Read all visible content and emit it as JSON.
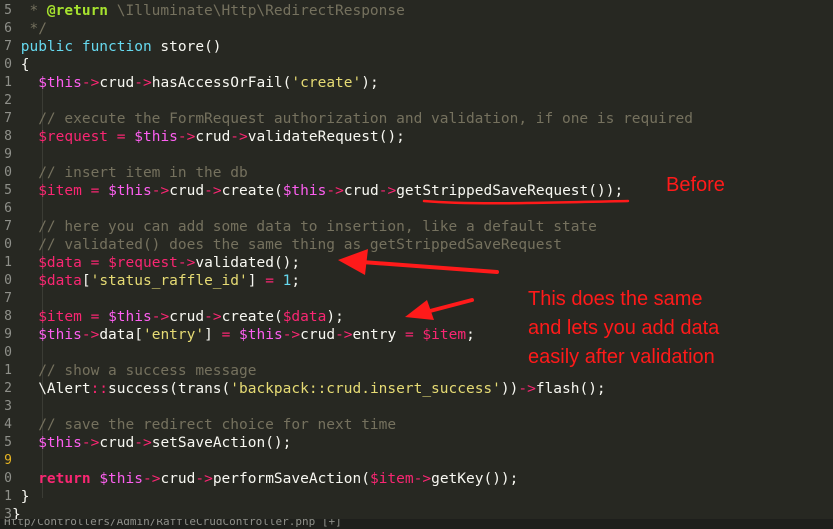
{
  "editor": {
    "lines": [
      {
        "n": "5",
        "mod": false,
        "tokens": [
          [
            "cm",
            "  * "
          ],
          [
            "doc",
            "@return"
          ],
          [
            "cm",
            " \\Illuminate\\Http\\RedirectResponse"
          ]
        ]
      },
      {
        "n": "6",
        "mod": false,
        "tokens": [
          [
            "cm",
            "  */"
          ]
        ]
      },
      {
        "n": "7",
        "mod": false,
        "tokens": [
          [
            "kw",
            " public"
          ],
          [
            "fg",
            " "
          ],
          [
            "kw",
            "function"
          ],
          [
            "fg",
            " store()"
          ]
        ]
      },
      {
        "n": "0",
        "mod": false,
        "tokens": [
          [
            "fg",
            " {"
          ]
        ]
      },
      {
        "n": "1",
        "mod": false,
        "tokens": [
          [
            "fg",
            "   "
          ],
          [
            "var",
            "$this"
          ],
          [
            "op",
            "->"
          ],
          [
            "fg",
            "crud"
          ],
          [
            "op",
            "->"
          ],
          [
            "fg",
            "hasAccessOrFail("
          ],
          [
            "str",
            "'create'"
          ],
          [
            "fg",
            ");"
          ]
        ]
      },
      {
        "n": "2",
        "mod": false,
        "tokens": []
      },
      {
        "n": "7",
        "mod": false,
        "tokens": [
          [
            "cm",
            "   // execute the FormRequest authorization and validation, if one is required"
          ]
        ]
      },
      {
        "n": "8",
        "mod": false,
        "tokens": [
          [
            "fg",
            "   "
          ],
          [
            "vr",
            "$request"
          ],
          [
            "op",
            " = "
          ],
          [
            "var",
            "$this"
          ],
          [
            "op",
            "->"
          ],
          [
            "fg",
            "crud"
          ],
          [
            "op",
            "->"
          ],
          [
            "fg",
            "validateRequest();"
          ]
        ]
      },
      {
        "n": "9",
        "mod": false,
        "tokens": []
      },
      {
        "n": "0",
        "mod": false,
        "tokens": [
          [
            "cm",
            "   // insert item in the db"
          ]
        ]
      },
      {
        "n": "5",
        "mod": false,
        "tokens": [
          [
            "fg",
            "   "
          ],
          [
            "vr",
            "$item"
          ],
          [
            "op",
            " = "
          ],
          [
            "var",
            "$this"
          ],
          [
            "op",
            "->"
          ],
          [
            "fg",
            "crud"
          ],
          [
            "op",
            "->"
          ],
          [
            "fg",
            "create("
          ],
          [
            "var",
            "$this"
          ],
          [
            "op",
            "->"
          ],
          [
            "fg",
            "crud"
          ],
          [
            "op",
            "->"
          ],
          [
            "fg",
            "getStrippedSaveRequest());"
          ]
        ]
      },
      {
        "n": "6",
        "mod": false,
        "tokens": []
      },
      {
        "n": "7",
        "mod": false,
        "tokens": [
          [
            "cm",
            "   // here you can add some data to insertion, like a default state"
          ]
        ]
      },
      {
        "n": "0",
        "mod": false,
        "tokens": [
          [
            "cm",
            "   // validated() does the same thing as getStrippedSaveRequest"
          ]
        ]
      },
      {
        "n": "1",
        "mod": false,
        "tokens": [
          [
            "fg",
            "   "
          ],
          [
            "vr",
            "$data"
          ],
          [
            "op",
            " = "
          ],
          [
            "vr",
            "$request"
          ],
          [
            "op",
            "->"
          ],
          [
            "fg",
            "validated();"
          ]
        ]
      },
      {
        "n": "0",
        "mod": false,
        "tokens": [
          [
            "fg",
            "   "
          ],
          [
            "vr",
            "$data"
          ],
          [
            "fg",
            "["
          ],
          [
            "str",
            "'status_raffle_id'"
          ],
          [
            "fg",
            "] "
          ],
          [
            "op",
            "="
          ],
          [
            "fg",
            " "
          ],
          [
            "kw",
            "1"
          ],
          [
            "fg",
            ";"
          ]
        ]
      },
      {
        "n": "7",
        "mod": false,
        "tokens": []
      },
      {
        "n": "8",
        "mod": false,
        "tokens": [
          [
            "fg",
            "   "
          ],
          [
            "vr",
            "$item"
          ],
          [
            "op",
            " = "
          ],
          [
            "var",
            "$this"
          ],
          [
            "op",
            "->"
          ],
          [
            "fg",
            "crud"
          ],
          [
            "op",
            "->"
          ],
          [
            "fg",
            "create("
          ],
          [
            "vr",
            "$data"
          ],
          [
            "fg",
            ");"
          ]
        ]
      },
      {
        "n": "9",
        "mod": false,
        "tokens": [
          [
            "fg",
            "   "
          ],
          [
            "var",
            "$this"
          ],
          [
            "op",
            "->"
          ],
          [
            "fg",
            "data["
          ],
          [
            "str",
            "'entry'"
          ],
          [
            "fg",
            "] "
          ],
          [
            "op",
            "="
          ],
          [
            "fg",
            " "
          ],
          [
            "var",
            "$this"
          ],
          [
            "op",
            "->"
          ],
          [
            "fg",
            "crud"
          ],
          [
            "op",
            "->"
          ],
          [
            "fg",
            "entry "
          ],
          [
            "op",
            "="
          ],
          [
            "fg",
            " "
          ],
          [
            "vr",
            "$item"
          ],
          [
            "fg",
            ";"
          ]
        ]
      },
      {
        "n": "0",
        "mod": false,
        "tokens": []
      },
      {
        "n": "1",
        "mod": false,
        "tokens": [
          [
            "cm",
            "   // show a success message"
          ]
        ]
      },
      {
        "n": "2",
        "mod": false,
        "tokens": [
          [
            "fg",
            "   \\Alert"
          ],
          [
            "op",
            "::"
          ],
          [
            "fg",
            "success(trans("
          ],
          [
            "str",
            "'backpack::crud.insert_success'"
          ],
          [
            "fg",
            "))"
          ],
          [
            "op",
            "->"
          ],
          [
            "fg",
            "flash();"
          ]
        ]
      },
      {
        "n": "3",
        "mod": false,
        "tokens": []
      },
      {
        "n": "4",
        "mod": false,
        "tokens": [
          [
            "cm",
            "   // save the redirect choice for next time"
          ]
        ]
      },
      {
        "n": "5",
        "mod": false,
        "tokens": [
          [
            "fg",
            "   "
          ],
          [
            "var",
            "$this"
          ],
          [
            "op",
            "->"
          ],
          [
            "fg",
            "crud"
          ],
          [
            "op",
            "->"
          ],
          [
            "fg",
            "setSaveAction();"
          ]
        ]
      },
      {
        "n": "9",
        "mod": true,
        "tokens": []
      },
      {
        "n": "0",
        "mod": false,
        "tokens": [
          [
            "ret",
            "   return"
          ],
          [
            "fg",
            " "
          ],
          [
            "var",
            "$this"
          ],
          [
            "op",
            "->"
          ],
          [
            "fg",
            "crud"
          ],
          [
            "op",
            "->"
          ],
          [
            "fg",
            "performSaveAction("
          ],
          [
            "vr",
            "$item"
          ],
          [
            "op",
            "->"
          ],
          [
            "fg",
            "getKey());"
          ]
        ]
      },
      {
        "n": "1",
        "mod": false,
        "tokens": [
          [
            "fg",
            " }"
          ]
        ]
      },
      {
        "n": "3",
        "mod": false,
        "tokens": [
          [
            "fg",
            "}"
          ]
        ]
      }
    ]
  },
  "annotations": {
    "before": "Before",
    "same_lines": [
      "This does the same",
      "and lets you add data",
      "easily after validation"
    ]
  },
  "status_bar": {
    "text": "Http/Controllers/Admin/RaffleCrudController.php [+]"
  },
  "colors": {
    "background": "#272822",
    "annotation": "#ff1a1a",
    "comment": "#75715e",
    "variable": "#fd5ff0",
    "string": "#e6db74",
    "keyword": "#66d9ef"
  }
}
